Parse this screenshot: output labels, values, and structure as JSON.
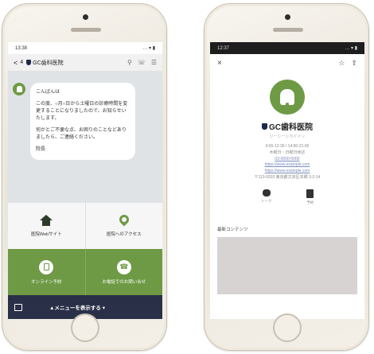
{
  "colors": {
    "accent_green": "#6e9a45",
    "navy_bar": "#2a3048",
    "chat_bg": "#dfe3e6"
  },
  "left_phone": {
    "status_time": "13:38",
    "status_right": "… ▾ ▮",
    "header": {
      "back": "<",
      "unread": "4",
      "clinic_name": "GC歯科医院"
    },
    "message": {
      "greeting": "こんばんは",
      "para1": "この度、○月○日から土曜日の診療時間を変更することになりましたので、お知らせいたします。",
      "para2": "何かとご不便な点、お困りのことなどありましたら、ご連絡ください。",
      "sign": "院長"
    },
    "menu": {
      "website": "医院Webサイト",
      "access": "医院へのアクセス",
      "online_booking": "オンライン予約",
      "phone_inquiry": "お電話でのお問い合せ"
    },
    "bottom_bar_label": "▲メニューを表示する ▾"
  },
  "right_phone": {
    "status_time": "12:37",
    "status_right": "… ▾ ▮",
    "close_icon_glyph": "×",
    "clinic_name": "GC歯科医院",
    "clinic_sub": "ジーシーシカイイン",
    "hours": "9:00-12:30 / 14:00-21:00",
    "closed": "木曜日・日曜日休診",
    "phone": "03-0000-0000",
    "url": "https://www.example.com",
    "url2": "https://www.example.com",
    "address": "〒113-0033 東京都文京区本郷 3-2-14",
    "action_chat": "トーク",
    "action_book": "予約",
    "contents_label": "最新コンテンツ"
  }
}
